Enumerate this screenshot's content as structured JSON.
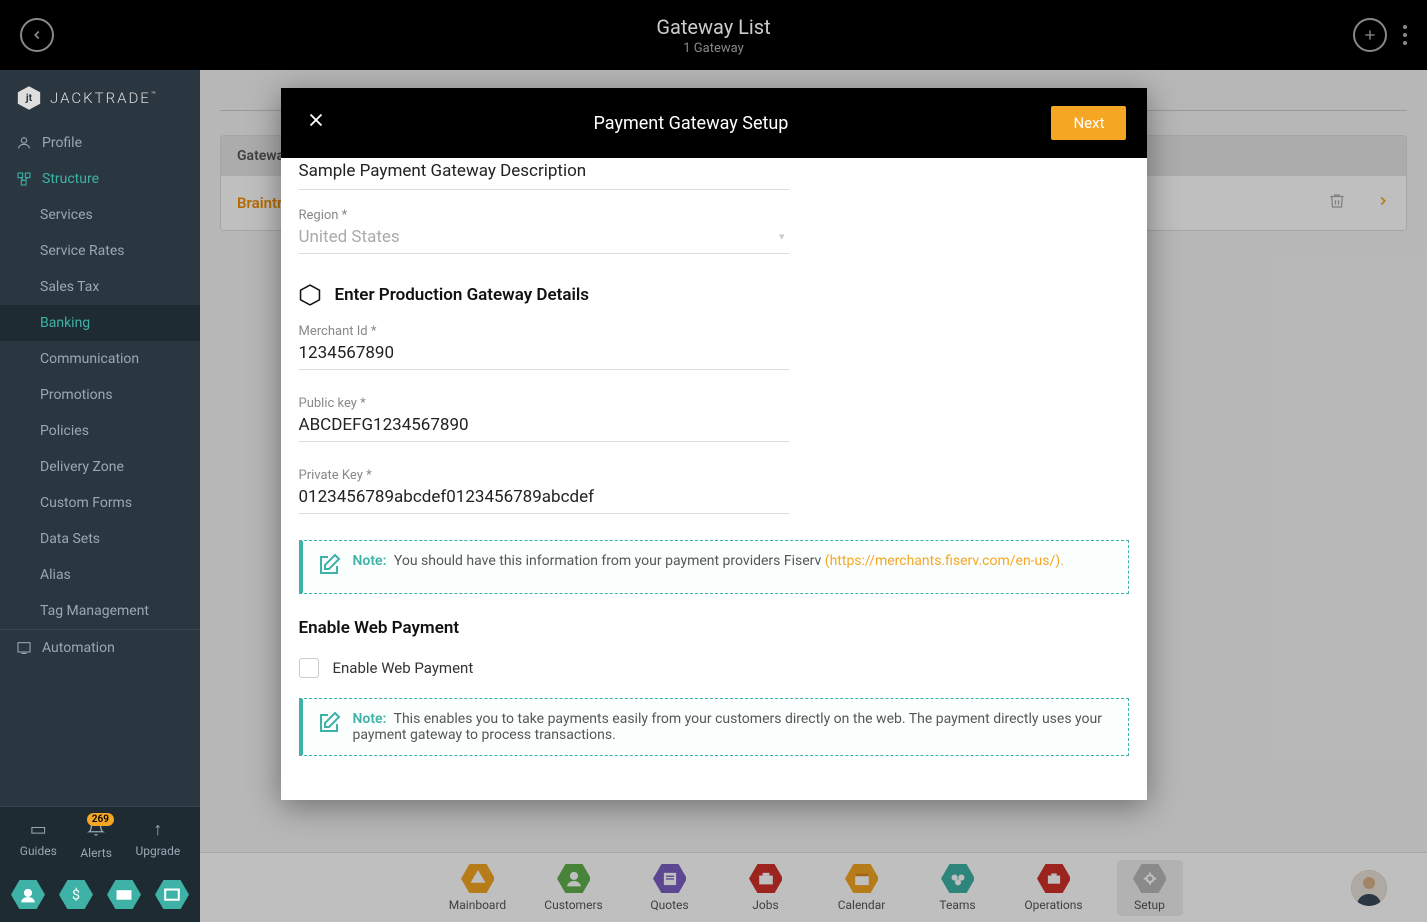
{
  "header": {
    "title": "Gateway List",
    "subtitle": "1 Gateway"
  },
  "brand": {
    "name": "JACKTRADE",
    "tm": "™"
  },
  "sidebar": {
    "items": [
      {
        "label": "Profile",
        "icon": "user-icon"
      },
      {
        "label": "Structure",
        "icon": "structure-icon",
        "active": true
      }
    ],
    "sub_items": [
      {
        "label": "Services"
      },
      {
        "label": "Service Rates"
      },
      {
        "label": "Sales Tax"
      },
      {
        "label": "Banking",
        "active": true
      },
      {
        "label": "Communication"
      },
      {
        "label": "Promotions"
      },
      {
        "label": "Policies"
      },
      {
        "label": "Delivery Zone"
      },
      {
        "label": "Custom Forms"
      },
      {
        "label": "Data Sets"
      },
      {
        "label": "Alias"
      },
      {
        "label": "Tag Management"
      }
    ],
    "automation_label": "Automation",
    "bottom1": {
      "guides": "Guides",
      "alerts": "Alerts",
      "alerts_badge": "269",
      "upgrade": "Upgrade"
    }
  },
  "main": {
    "table_header": "Gateway Name",
    "row_name": "Braintree"
  },
  "bottom_nav": {
    "items": [
      {
        "label": "Mainboard",
        "color": "#f5a623"
      },
      {
        "label": "Customers",
        "color": "#5fb04e"
      },
      {
        "label": "Quotes",
        "color": "#7a5fc3"
      },
      {
        "label": "Jobs",
        "color": "#d0302a"
      },
      {
        "label": "Calendar",
        "color": "#f5a623"
      },
      {
        "label": "Teams",
        "color": "#3eb2a6"
      },
      {
        "label": "Operations",
        "color": "#d0302a"
      },
      {
        "label": "Setup",
        "color": "#b8b8b8",
        "active": true
      }
    ]
  },
  "modal": {
    "title": "Payment Gateway Setup",
    "next_label": "Next",
    "description_value": "Sample Payment Gateway Description",
    "region_label": "Region *",
    "region_value": "United States",
    "gateway_section_title": "Enter Production Gateway Details",
    "merchant_label": "Merchant Id *",
    "merchant_value": "1234567890",
    "public_label": "Public key *",
    "public_value": "ABCDEFG1234567890",
    "private_label": "Private Key *",
    "private_value": "0123456789abcdef0123456789abcdef",
    "note1_label": "Note:",
    "note1_text": "You should have this information from your payment providers Fiserv ",
    "note1_link": "(https://merchants.fiserv.com/en-us/).",
    "enable_title": "Enable Web Payment",
    "enable_checkbox_label": "Enable Web Payment",
    "note2_label": "Note:",
    "note2_text": "This enables you to take payments easily from your customers directly on the web. The payment directly uses your payment gateway to process transactions."
  }
}
